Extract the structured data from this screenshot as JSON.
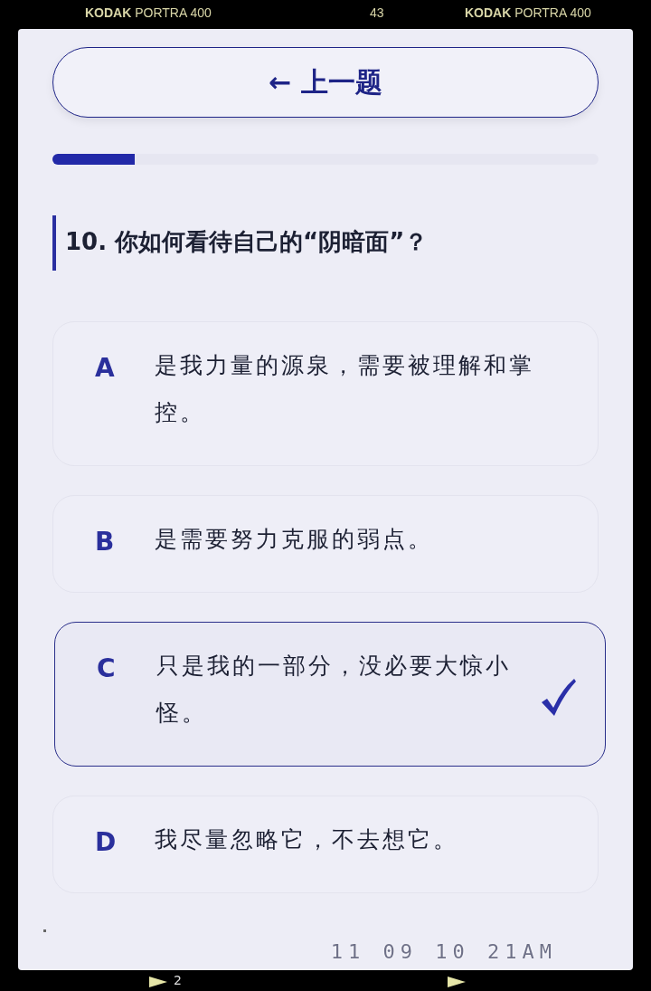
{
  "film_frame": {
    "top_labels": [
      "**KODAK** PORTRA 400",
      "43",
      "**KODAK** PORTRA 400"
    ],
    "date_stamp": "11 09 10 21AM",
    "frame_number": "2"
  },
  "back_button": {
    "label": "← 上一题"
  },
  "progress": {
    "level": 0.15
  },
  "question": {
    "text": "10. 你如何看待自己的“阴暗面”？"
  },
  "options": [
    {
      "letter": "A",
      "text": "是我力量的源泉，需要被理解和掌控。",
      "selected": false
    },
    {
      "letter": "B",
      "text": "是需要努力克服的弱点。",
      "selected": false
    },
    {
      "letter": "C",
      "text": "只是我的一部分，没必要大惊小怪。",
      "selected": true
    },
    {
      "letter": "D",
      "text": "我尽量忽略它，不去想它。",
      "selected": false
    }
  ]
}
